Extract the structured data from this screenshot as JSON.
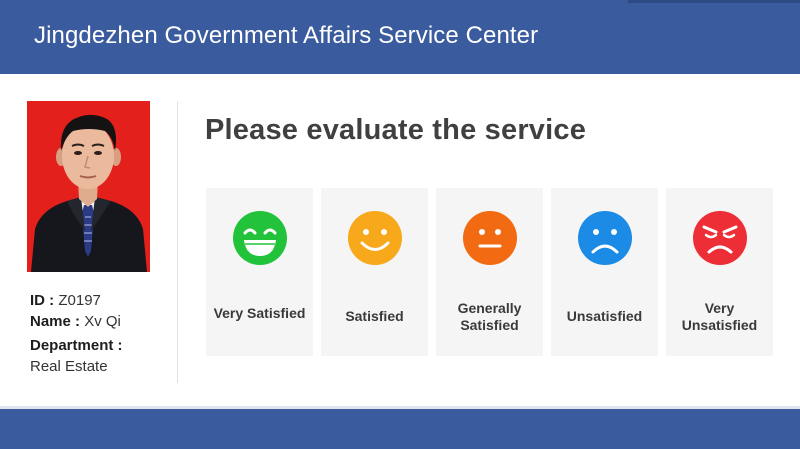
{
  "header": {
    "title": "Jingdezhen Government Affairs Service Center"
  },
  "staff": {
    "id_label": "ID :",
    "id_value": "Z0197",
    "name_label": "Name :",
    "name_value": "Xv Qi",
    "department_label": "Department :",
    "department_value": "Real Estate"
  },
  "evaluation": {
    "prompt": "Please evaluate the service",
    "options": [
      {
        "label_line1": "Very  Satisfied",
        "label_line2": "",
        "color": "#22c33a",
        "icon": "laughing-face-icon"
      },
      {
        "label_line1": "Satisfied",
        "label_line2": "",
        "color": "#f7a81b",
        "icon": "smiling-face-icon"
      },
      {
        "label_line1": "Generally",
        "label_line2": "Satisfied",
        "color": "#f26a12",
        "icon": "neutral-face-icon"
      },
      {
        "label_line1": "Unsatisfied",
        "label_line2": "",
        "color": "#1b8be6",
        "icon": "frowning-face-icon"
      },
      {
        "label_line1": "Very",
        "label_line2": "Unsatisfied",
        "color": "#ee2e36",
        "icon": "upset-face-icon"
      }
    ]
  },
  "colors": {
    "header_bg": "#3a5b9e",
    "card_bg": "#f5f5f5",
    "photo_bg": "#e8231e"
  }
}
